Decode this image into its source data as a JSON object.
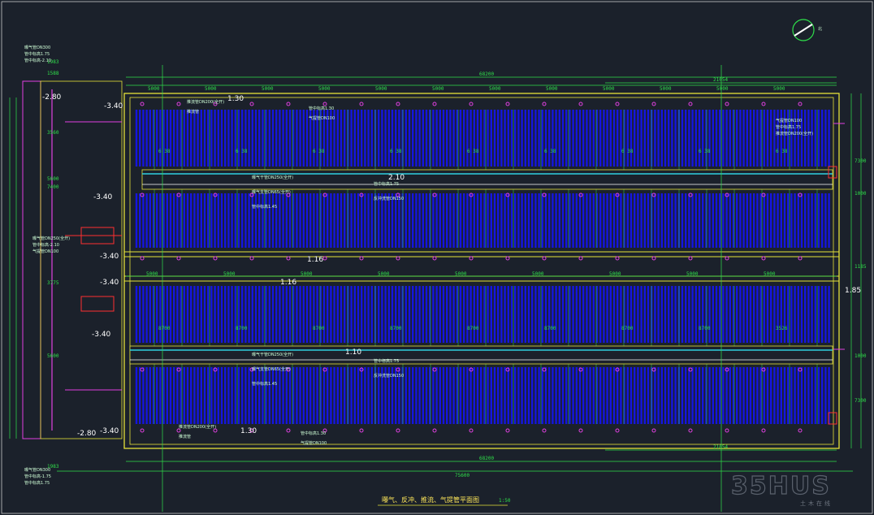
{
  "drawing": {
    "title": "曝气、反冲、推流、气提管平面图",
    "title_suffix": "1:50",
    "north_label": "北",
    "colors": {
      "background": "#1b212b",
      "pipe_blue": "#1515e0",
      "frame_yellow": "#e6e23a",
      "dim_green": "#2fe04a",
      "magenta": "#e040e0",
      "cyan": "#30d0e0",
      "red": "#ff3030",
      "white": "#ffffff"
    }
  },
  "dimensions": {
    "top_total": "68200",
    "bottom_total_inner": "68200",
    "bottom_total_outer": "75600",
    "top_segments": [
      "5000",
      "5000",
      "5000",
      "5000",
      "5000",
      "5000",
      "5000",
      "5000",
      "5000",
      "5000",
      "5000",
      "5000"
    ],
    "top_right_span": "21054",
    "bottom_right_span": "21054",
    "mid_segments": [
      "5000",
      "5000",
      "5000",
      "5000",
      "5000",
      "5000",
      "5000",
      "5000",
      "5000"
    ],
    "row_upper": [
      "6 38",
      "6 38",
      "6 38",
      "6 38",
      "6 38",
      "6 38",
      "6 38",
      "6 38",
      "6 38"
    ],
    "row_lower": [
      "8700",
      "8700",
      "8700",
      "8700",
      "8700",
      "8700",
      "8700",
      "8700",
      "3526"
    ],
    "left_side": [
      "1983",
      "1588",
      "3560",
      "5600",
      "7400",
      "3775",
      "5600",
      "1983"
    ],
    "right_side": [
      "7300",
      "1000",
      "1185",
      "7300",
      "1000"
    ]
  },
  "levels": {
    "top_left": "-3.40",
    "upper_mid": "-3.40",
    "mid_a": "-3.40",
    "mid_b": "-3.40",
    "mid_c": "-3.40",
    "bottom_left": "-3.40",
    "channel_upper": "2.10",
    "channel_lower": "1.10",
    "walkway_a": "1.16",
    "walkway_b": "1.16",
    "top_edge": "1.30",
    "bottom_edge": "1.30",
    "right_mid": "1.85",
    "left_a": "-2.80",
    "left_b": "-2.80"
  },
  "annotations": {
    "upper_channel": [
      "曝气干管DN250(全开)",
      "管中标高1.75",
      "曝气支管DN65(全开)",
      "反冲洗管DN150",
      "管中标高1.45"
    ],
    "lower_channel": [
      "曝气干管DN250(全开)",
      "管中标高1.75",
      "曝气支管DN65(全开)",
      "反冲洗管DN150",
      "管中标高1.45"
    ],
    "left_top": [
      "曝气管DN300",
      "管中标高1.75",
      "管中标高-2.10"
    ],
    "left_mid": [
      "曝气管DN250(全开)",
      "管中标高-2.10",
      "气提管DN100"
    ],
    "left_bottom": [
      "曝气管DN300",
      "管中标高-1.75",
      "管中标高1.75"
    ],
    "right_side": [
      "气提管DN100",
      "管中标高1.75",
      "推流管DN200(全开)"
    ],
    "top_row": [
      "推流管DN200(全开)",
      "管中标高1.30",
      "推流管",
      "气提管DN100"
    ],
    "bottom_row": [
      "推流管DN200(全开)",
      "管中标高1.30",
      "推流管",
      "气提管DN100"
    ]
  },
  "watermark": {
    "text": "35HUS",
    "sub": "土木在线"
  }
}
